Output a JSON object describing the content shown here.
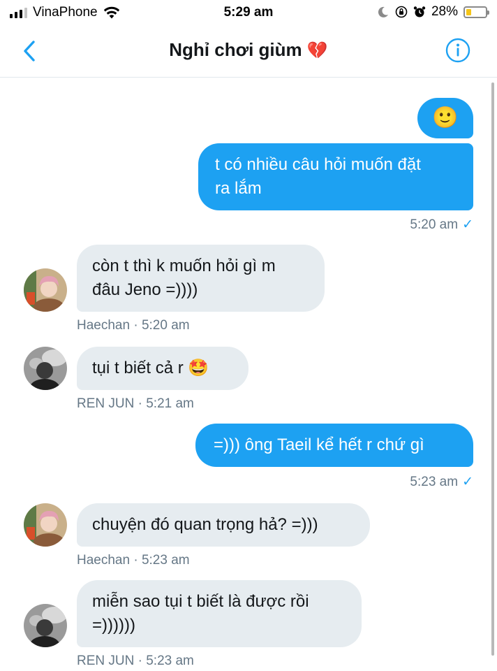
{
  "status_bar": {
    "carrier": "VinaPhone",
    "time": "5:29 am",
    "battery_percent": "28%",
    "battery_level": 0.28,
    "battery_color": "#f5c518",
    "icons": [
      "signal-icon",
      "wifi-icon",
      "moon-icon",
      "orientation-lock-icon",
      "alarm-icon",
      "battery-icon"
    ]
  },
  "header": {
    "title": "Nghỉ chơi giùm",
    "title_emoji": "💔",
    "back_icon": "chevron-left-icon",
    "info_icon": "info-icon",
    "accent_color": "#1da1f2"
  },
  "messages": [
    {
      "direction": "out",
      "text": "🙂"
    },
    {
      "direction": "out",
      "lines": [
        "t có nhiều câu hỏi muốn đặt",
        "ra lắm"
      ],
      "time": "5:20 am",
      "check": "✓"
    },
    {
      "direction": "in",
      "lines": [
        "còn t thì k muốn hỏi gì m",
        "đâu Jeno =))))"
      ],
      "sender": "Haechan",
      "time": "5:20 am",
      "meta": "Haechan · 5:20 am"
    },
    {
      "direction": "in",
      "text": "tụi t biết cả r 🤩",
      "sender": "REN JUN",
      "time": "5:21 am",
      "meta": "REN JUN · 5:21 am"
    },
    {
      "direction": "out",
      "text": "=))) ông Taeil kể hết r chứ gì",
      "time": "5:23 am",
      "check": "✓"
    },
    {
      "direction": "in",
      "text": "chuyện đó quan trọng hả? =)))",
      "sender": "Haechan",
      "time": "5:23 am",
      "meta": "Haechan · 5:23 am"
    },
    {
      "direction": "in",
      "lines": [
        "miễn sao tụi t biết là được rồi",
        "=))))))"
      ],
      "sender": "REN JUN",
      "time": "5:23 am",
      "meta": "REN JUN · 5:23 am"
    }
  ],
  "colors": {
    "outgoing_bubble": "#1da1f2",
    "incoming_bubble": "#e6ecf0",
    "meta_text": "#657786"
  }
}
